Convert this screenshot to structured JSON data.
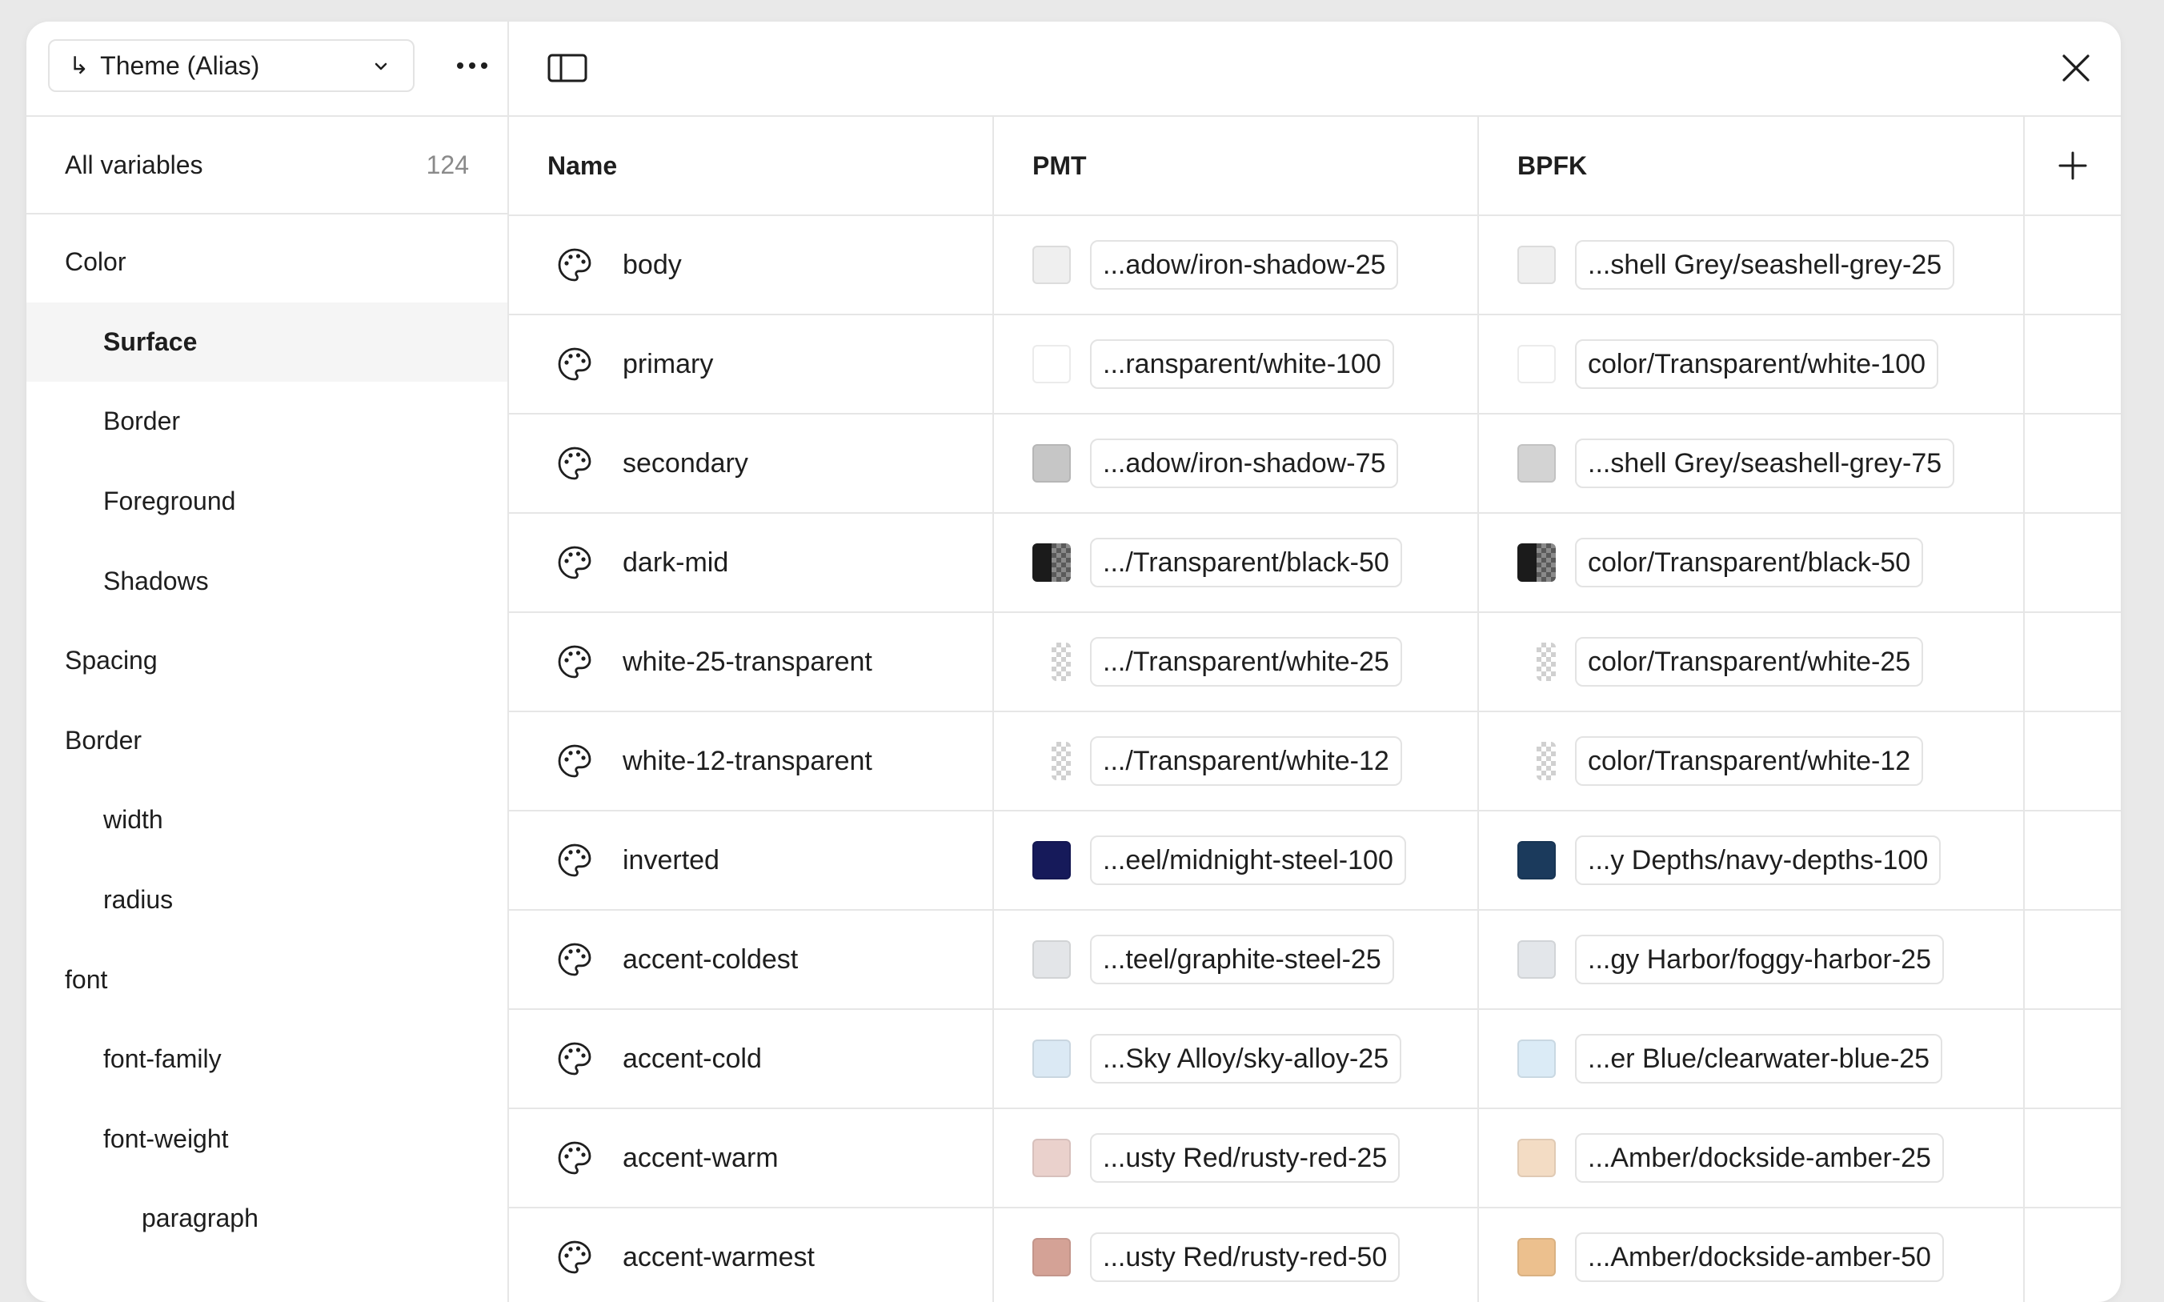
{
  "header": {
    "mode_label": "Theme (Alias)",
    "mode_icon": "alias-arrow-icon"
  },
  "sidebar": {
    "all_variables_label": "All variables",
    "all_variables_count": "124",
    "groups": [
      {
        "label": "Color",
        "level": 0
      },
      {
        "label": "Surface",
        "level": 1,
        "active": true
      },
      {
        "label": "Border",
        "level": 1
      },
      {
        "label": "Foreground",
        "level": 1
      },
      {
        "label": "Shadows",
        "level": 1
      },
      {
        "label": "Spacing",
        "level": 0
      },
      {
        "label": "Border",
        "level": 0
      },
      {
        "label": "width",
        "level": 1
      },
      {
        "label": "radius",
        "level": 1
      },
      {
        "label": "font",
        "level": 0
      },
      {
        "label": "font-family",
        "level": 1
      },
      {
        "label": "font-weight",
        "level": 1
      },
      {
        "label": "paragraph",
        "level": 2
      }
    ]
  },
  "table": {
    "columns": {
      "name": "Name",
      "mode1": "PMT",
      "mode2": "BPFK"
    },
    "rows": [
      {
        "name": "body",
        "pmt": {
          "swatch": "#efefef",
          "alias": "...adow/iron-shadow-25"
        },
        "bpfk": {
          "swatch": "#efefef",
          "alias": "...shell Grey/seashell-grey-25"
        }
      },
      {
        "name": "primary",
        "pmt": {
          "swatch": "#ffffff",
          "alias": "...ransparent/white-100"
        },
        "bpfk": {
          "swatch": "#ffffff",
          "alias": "color/Transparent/white-100"
        }
      },
      {
        "name": "secondary",
        "pmt": {
          "swatch": "#c6c6c6",
          "alias": "...adow/iron-shadow-75"
        },
        "bpfk": {
          "swatch": "#d3d3d3",
          "alias": "...shell Grey/seashell-grey-75"
        }
      },
      {
        "name": "dark-mid",
        "pmt": {
          "swatch": "half-black",
          "alias": ".../Transparent/black-50"
        },
        "bpfk": {
          "swatch": "half-black",
          "alias": "color/Transparent/black-50"
        }
      },
      {
        "name": "white-25-transparent",
        "pmt": {
          "swatch": "checker",
          "alias": ".../Transparent/white-25"
        },
        "bpfk": {
          "swatch": "checker",
          "alias": "color/Transparent/white-25"
        }
      },
      {
        "name": "white-12-transparent",
        "pmt": {
          "swatch": "checker",
          "alias": ".../Transparent/white-12"
        },
        "bpfk": {
          "swatch": "checker",
          "alias": "color/Transparent/white-12"
        }
      },
      {
        "name": "inverted",
        "pmt": {
          "swatch": "#161a5a",
          "alias": "...eel/midnight-steel-100"
        },
        "bpfk": {
          "swatch": "#1b3a5c",
          "alias": "...y Depths/navy-depths-100"
        }
      },
      {
        "name": "accent-coldest",
        "pmt": {
          "swatch": "#e3e5e8",
          "alias": "...teel/graphite-steel-25"
        },
        "bpfk": {
          "swatch": "#e3e6ea",
          "alias": "...gy Harbor/foggy-harbor-25"
        }
      },
      {
        "name": "accent-cold",
        "pmt": {
          "swatch": "#dbe9f4",
          "alias": "...Sky Alloy/sky-alloy-25"
        },
        "bpfk": {
          "swatch": "#dbebf6",
          "alias": "...er Blue/clearwater-blue-25"
        }
      },
      {
        "name": "accent-warm",
        "pmt": {
          "swatch": "#ead1cc",
          "alias": "...usty Red/rusty-red-25"
        },
        "bpfk": {
          "swatch": "#f3dcc4",
          "alias": "...Amber/dockside-amber-25"
        }
      },
      {
        "name": "accent-warmest",
        "pmt": {
          "swatch": "#d4a296",
          "alias": "...usty Red/rusty-red-50"
        },
        "bpfk": {
          "swatch": "#ecc08e",
          "alias": "...Amber/dockside-amber-50"
        }
      }
    ]
  }
}
